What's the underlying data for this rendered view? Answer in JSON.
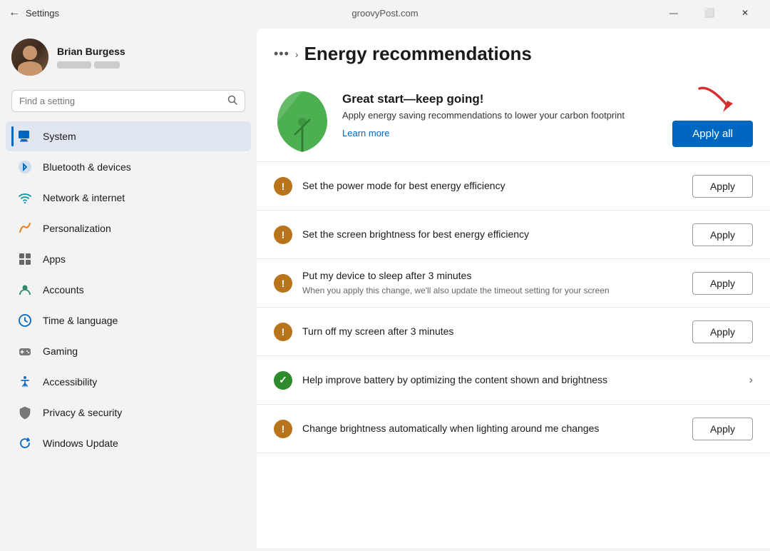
{
  "titlebar": {
    "back_label": "←",
    "app_title": "Settings",
    "watermark": "groovyPost.com",
    "minimize": "—",
    "maximize": "⬜",
    "close": "✕"
  },
  "sidebar": {
    "user_name": "Brian Burgess",
    "search_placeholder": "Find a setting",
    "nav_items": [
      {
        "id": "system",
        "label": "System",
        "active": true
      },
      {
        "id": "bluetooth",
        "label": "Bluetooth & devices",
        "active": false
      },
      {
        "id": "network",
        "label": "Network & internet",
        "active": false
      },
      {
        "id": "personalization",
        "label": "Personalization",
        "active": false
      },
      {
        "id": "apps",
        "label": "Apps",
        "active": false
      },
      {
        "id": "accounts",
        "label": "Accounts",
        "active": false
      },
      {
        "id": "time",
        "label": "Time & language",
        "active": false
      },
      {
        "id": "gaming",
        "label": "Gaming",
        "active": false
      },
      {
        "id": "accessibility",
        "label": "Accessibility",
        "active": false
      },
      {
        "id": "privacy",
        "label": "Privacy & security",
        "active": false
      },
      {
        "id": "update",
        "label": "Windows Update",
        "active": false
      }
    ]
  },
  "content": {
    "breadcrumb_dots": "•••",
    "breadcrumb_chevron": "›",
    "page_title": "Energy recommendations",
    "hero": {
      "title": "Great start—keep going!",
      "description": "Apply energy saving recommendations to lower your carbon footprint",
      "learn_more": "Learn more",
      "apply_all_label": "Apply all"
    },
    "recommendations": [
      {
        "id": "power-mode",
        "icon_type": "warning",
        "main_text": "Set the power mode for best energy efficiency",
        "sub_text": "",
        "action": "apply",
        "action_label": "Apply"
      },
      {
        "id": "brightness",
        "icon_type": "warning",
        "main_text": "Set the screen brightness for best energy efficiency",
        "sub_text": "",
        "action": "apply",
        "action_label": "Apply"
      },
      {
        "id": "sleep",
        "icon_type": "warning",
        "main_text": "Put my device to sleep after 3 minutes",
        "sub_text": "When you apply this change, we'll also update the timeout setting for your screen",
        "action": "apply",
        "action_label": "Apply"
      },
      {
        "id": "screen-off",
        "icon_type": "warning",
        "main_text": "Turn off my screen after 3 minutes",
        "sub_text": "",
        "action": "apply",
        "action_label": "Apply"
      },
      {
        "id": "battery",
        "icon_type": "success",
        "main_text": "Help improve battery by optimizing the content shown and brightness",
        "sub_text": "",
        "action": "chevron",
        "action_label": "›"
      },
      {
        "id": "auto-brightness",
        "icon_type": "warning",
        "main_text": "Change brightness automatically when lighting around me changes",
        "sub_text": "",
        "action": "apply",
        "action_label": "Apply"
      }
    ]
  }
}
